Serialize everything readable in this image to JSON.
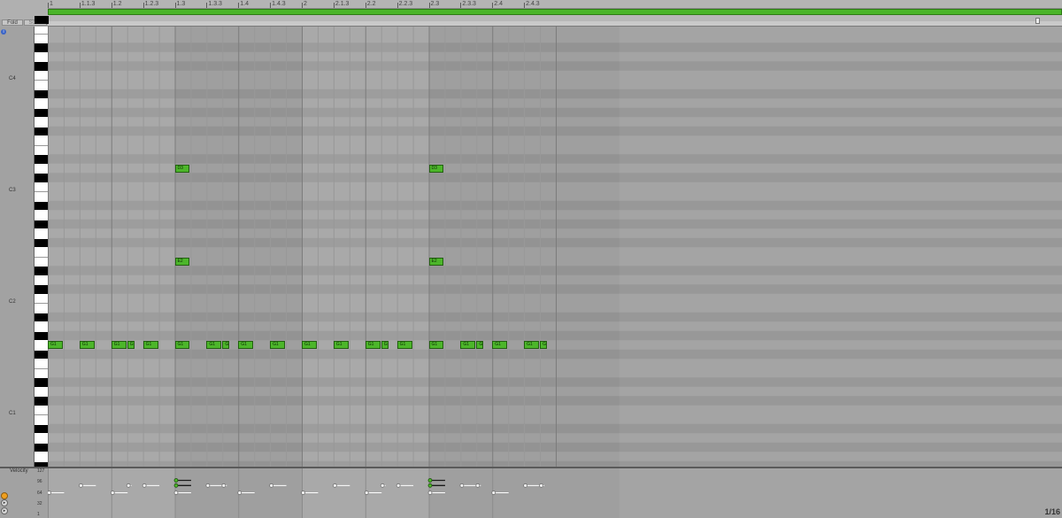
{
  "ruler": {
    "labels": [
      "1",
      "1.1.3",
      "1.2",
      "1.2.3",
      "1.3",
      "1.3.3",
      "1.4",
      "1.4.3",
      "2",
      "2.1.3",
      "2.2",
      "2.2.3",
      "2.3",
      "2.3.3",
      "2.4",
      "2.4.3"
    ]
  },
  "buttons": {
    "fold_label": "Fold",
    "scale_label": "Scale"
  },
  "piano_roll": {
    "octave_labels": [
      "C4",
      "C3",
      "C2",
      "C1"
    ],
    "beats_total": 8
  },
  "notes": [
    {
      "label": "D3",
      "beat": 2.0,
      "length": 0.25,
      "pitch": "D3"
    },
    {
      "label": "D3",
      "beat": 6.0,
      "length": 0.25,
      "pitch": "D3"
    },
    {
      "label": "E2",
      "beat": 2.0,
      "length": 0.25,
      "pitch": "E2"
    },
    {
      "label": "E2",
      "beat": 6.0,
      "length": 0.25,
      "pitch": "E2"
    },
    {
      "label": "G1",
      "beat": 0.0,
      "length": 0.25,
      "pitch": "G1"
    },
    {
      "label": "G1",
      "beat": 0.5,
      "length": 0.25,
      "pitch": "G1"
    },
    {
      "label": "G1",
      "beat": 1.0,
      "length": 0.25,
      "pitch": "G1"
    },
    {
      "label": "G",
      "beat": 1.25,
      "length": 0.0625,
      "pitch": "G1"
    },
    {
      "label": "G1",
      "beat": 1.5,
      "length": 0.25,
      "pitch": "G1"
    },
    {
      "label": "G1",
      "beat": 2.0,
      "length": 0.25,
      "pitch": "G1"
    },
    {
      "label": "G1",
      "beat": 2.5,
      "length": 0.25,
      "pitch": "G1"
    },
    {
      "label": "G",
      "beat": 2.75,
      "length": 0.0625,
      "pitch": "G1"
    },
    {
      "label": "G1",
      "beat": 3.0,
      "length": 0.25,
      "pitch": "G1"
    },
    {
      "label": "G1",
      "beat": 3.5,
      "length": 0.25,
      "pitch": "G1"
    },
    {
      "label": "G1",
      "beat": 4.0,
      "length": 0.25,
      "pitch": "G1"
    },
    {
      "label": "G1",
      "beat": 4.5,
      "length": 0.25,
      "pitch": "G1"
    },
    {
      "label": "G1",
      "beat": 5.0,
      "length": 0.25,
      "pitch": "G1"
    },
    {
      "label": "G",
      "beat": 5.25,
      "length": 0.0625,
      "pitch": "G1"
    },
    {
      "label": "G1",
      "beat": 5.5,
      "length": 0.25,
      "pitch": "G1"
    },
    {
      "label": "G1",
      "beat": 6.0,
      "length": 0.25,
      "pitch": "G1"
    },
    {
      "label": "G1",
      "beat": 6.5,
      "length": 0.25,
      "pitch": "G1"
    },
    {
      "label": "G",
      "beat": 6.75,
      "length": 0.0625,
      "pitch": "G1"
    },
    {
      "label": "G1",
      "beat": 7.0,
      "length": 0.25,
      "pitch": "G1"
    },
    {
      "label": "G1",
      "beat": 7.5,
      "length": 0.25,
      "pitch": "G1"
    },
    {
      "label": "G",
      "beat": 7.75,
      "length": 0.0625,
      "pitch": "G1"
    }
  ],
  "velocity": {
    "title": "Velocity",
    "axis_labels": [
      "127",
      "96",
      "64",
      "32",
      "1"
    ],
    "points": [
      {
        "beat": 0.0,
        "length": 0.25,
        "value": 64
      },
      {
        "beat": 0.5,
        "length": 0.25,
        "value": 85
      },
      {
        "beat": 1.0,
        "length": 0.25,
        "value": 64
      },
      {
        "beat": 1.25,
        "length": 0.0625,
        "value": 85
      },
      {
        "beat": 1.5,
        "length": 0.25,
        "value": 85
      },
      {
        "beat": 2.0,
        "length": 0.25,
        "value": 100
      },
      {
        "beat": 2.0,
        "length": 0.25,
        "value": 85
      },
      {
        "beat": 2.0,
        "length": 0.25,
        "value": 64
      },
      {
        "beat": 2.5,
        "length": 0.25,
        "value": 85
      },
      {
        "beat": 2.75,
        "length": 0.0625,
        "value": 85
      },
      {
        "beat": 3.0,
        "length": 0.25,
        "value": 64
      },
      {
        "beat": 3.5,
        "length": 0.25,
        "value": 85
      },
      {
        "beat": 4.0,
        "length": 0.25,
        "value": 64
      },
      {
        "beat": 4.5,
        "length": 0.25,
        "value": 85
      },
      {
        "beat": 5.0,
        "length": 0.25,
        "value": 64
      },
      {
        "beat": 5.25,
        "length": 0.0625,
        "value": 85
      },
      {
        "beat": 5.5,
        "length": 0.25,
        "value": 85
      },
      {
        "beat": 6.0,
        "length": 0.25,
        "value": 100
      },
      {
        "beat": 6.0,
        "length": 0.25,
        "value": 85
      },
      {
        "beat": 6.0,
        "length": 0.25,
        "value": 64
      },
      {
        "beat": 6.5,
        "length": 0.25,
        "value": 85
      },
      {
        "beat": 6.75,
        "length": 0.0625,
        "value": 85
      },
      {
        "beat": 7.0,
        "length": 0.25,
        "value": 64
      },
      {
        "beat": 7.5,
        "length": 0.25,
        "value": 85
      },
      {
        "beat": 7.75,
        "length": 0.0625,
        "value": 85
      }
    ]
  },
  "grid_resolution": "1/16",
  "colors": {
    "note": "#4cb62a",
    "loop_bar": "#4bb52a",
    "velocity_line": "#ffffff",
    "velocity_line_selected": "#1a1a1a"
  },
  "icons": {
    "top_left": "info-icon",
    "vel_1": "orange-circle-icon",
    "vel_2": "play-icon",
    "vel_3": "play-icon"
  }
}
